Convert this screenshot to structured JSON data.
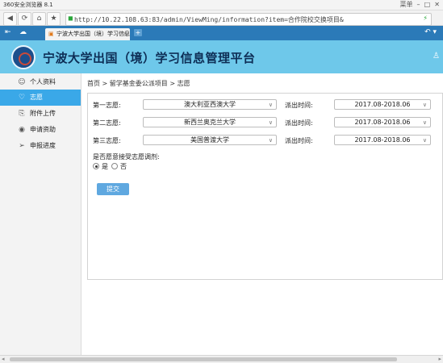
{
  "browser": {
    "title": "360安全浏览器 8.1",
    "menu_label": "菜单",
    "address": "http://10.22.108.63:83/admin/ViewMing/information?item=合作院校交换项目&",
    "tab_title": "宁波大学出国（境）学习信息管理"
  },
  "site": {
    "title": "宁波大学出国（境）学习信息管理平台"
  },
  "sidebar": {
    "items": [
      {
        "label": "个人资料",
        "icon": "user-icon"
      },
      {
        "label": "志愿",
        "icon": "heart-icon"
      },
      {
        "label": "附件上传",
        "icon": "attachment-icon"
      },
      {
        "label": "申请资助",
        "icon": "funding-icon"
      },
      {
        "label": "申报进度",
        "icon": "send-icon"
      }
    ]
  },
  "breadcrumb": "首页 > 留学基金委公派项目 > 志愿",
  "form": {
    "rows": [
      {
        "label": "第一志愿:",
        "university": "澳大利亚西澳大学",
        "time_label": "派出时间:",
        "time": "2017.08-2018.06"
      },
      {
        "label": "第二志愿:",
        "university": "新西兰奥克兰大学",
        "time_label": "派出时间:",
        "time": "2017.08-2018.06"
      },
      {
        "label": "第三志愿:",
        "university": "美国普渡大学",
        "time_label": "派出时间:",
        "time": "2017.08-2018.06"
      }
    ],
    "adjust_question": "是否愿意接受志愿调剂:",
    "yes_label": "是",
    "no_label": "否",
    "submit_label": "提交"
  },
  "colors": {
    "header": "#6ec8ea",
    "tabbar": "#2b7ab8",
    "active_menu": "#3aa8e8",
    "button": "#5fa8e0"
  }
}
